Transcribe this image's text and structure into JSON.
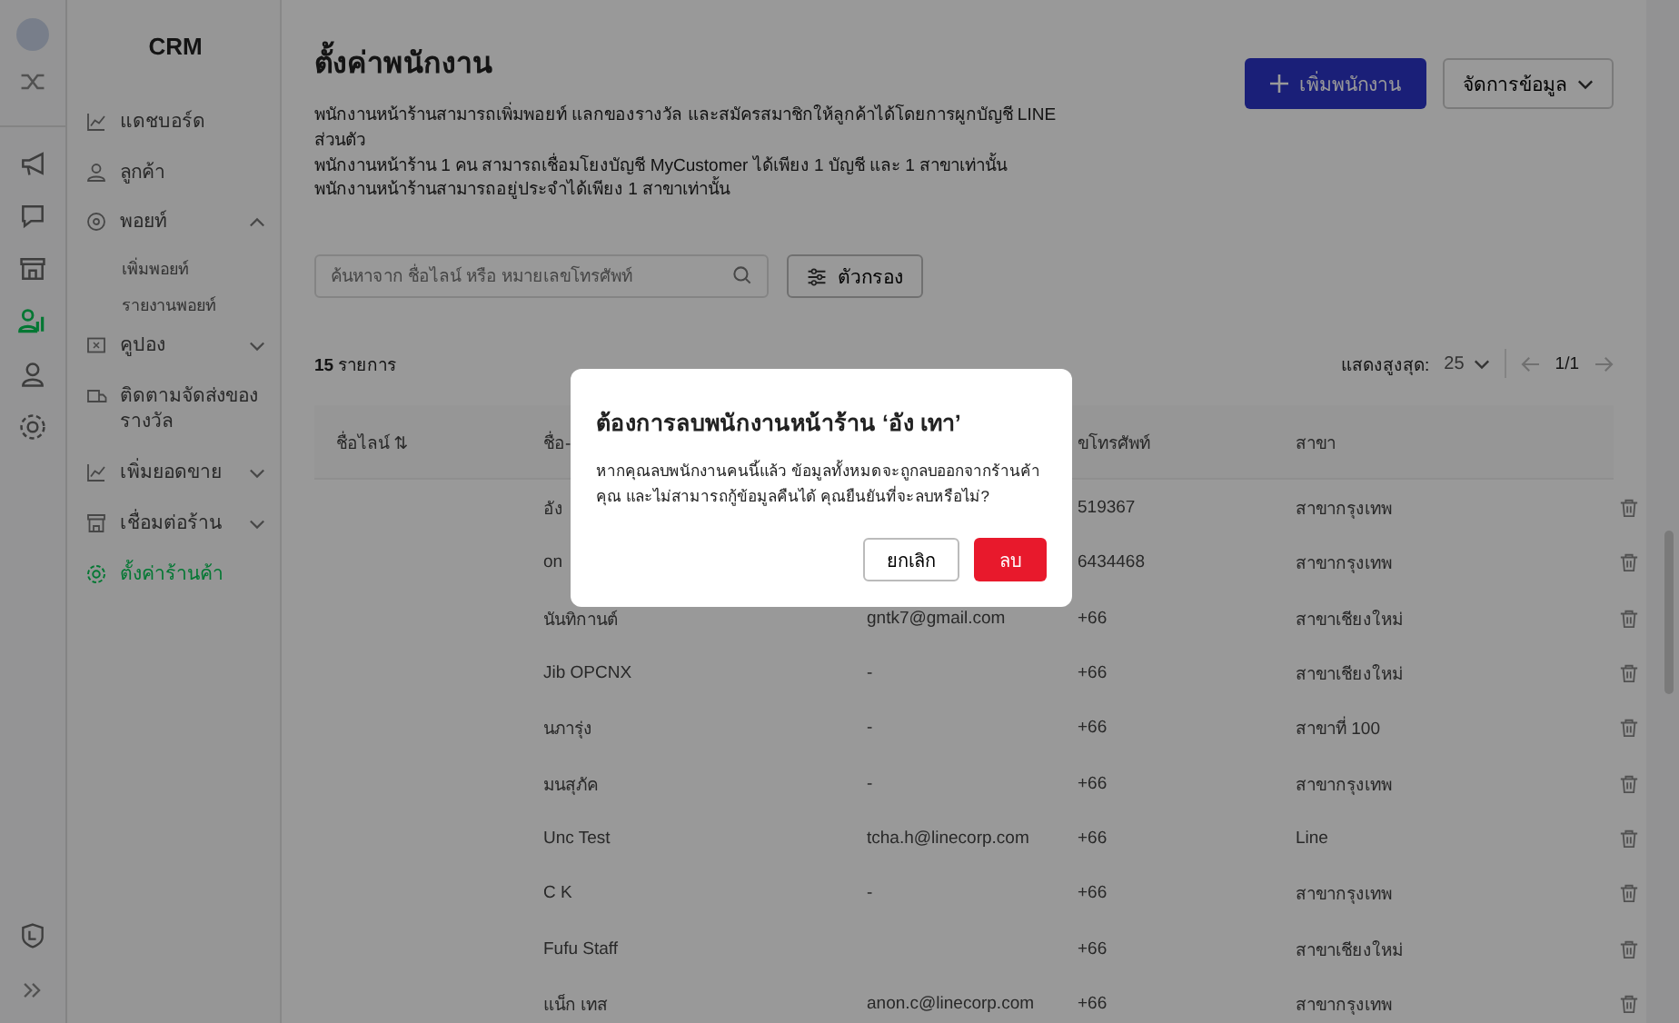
{
  "rail": {
    "top": [
      {
        "kind": "avatar"
      },
      {
        "kind": "shuffle"
      }
    ],
    "items": [
      {
        "kind": "megaphone",
        "selected": false
      },
      {
        "kind": "chat",
        "selected": false
      },
      {
        "kind": "store",
        "selected": false
      },
      {
        "kind": "staff",
        "selected": true
      },
      {
        "kind": "user",
        "selected": false
      },
      {
        "kind": "gear",
        "selected": false
      }
    ],
    "bottom": [
      {
        "kind": "shield"
      },
      {
        "kind": "expand"
      }
    ]
  },
  "sidebar": {
    "title": "CRM",
    "items": [
      {
        "label": "แดชบอร์ด",
        "selected": false
      },
      {
        "label": "ลูกค้า",
        "selected": false
      },
      {
        "label": "พอยท์",
        "selected": false,
        "expanded": true,
        "children": [
          {
            "label": "เพิ่มพอยท์",
            "selected": false
          },
          {
            "label": "รายงานพอยท์",
            "selected": false
          }
        ]
      },
      {
        "label": "คูปอง",
        "selected": false,
        "expanded": false
      },
      {
        "label": "ติดตามจัดส่งของรางวัล",
        "selected": false
      },
      {
        "label": "เพิ่มยอดขาย",
        "selected": false,
        "expanded": false
      },
      {
        "label": "เชื่อมต่อร้าน",
        "selected": false,
        "expanded": false
      },
      {
        "label": "ตั้งค่าร้านค้า",
        "selected": true
      }
    ]
  },
  "page": {
    "title": "ตั้งค่าพนักงาน",
    "description": [
      "พนักงานหน้าร้านสามารถเพิ่มพอยท์ แลกของรางวัล และสมัครสมาชิกให้ลูกค้าได้โดยการผูกบัญชี LINE ส่วนตัว",
      "พนักงานหน้าร้าน 1 คน สามารถเชื่อมโยงบัญชี MyCustomer ได้เพียง 1 บัญชี และ 1 สาขาเท่านั้น",
      "พนักงานหน้าร้านสามารถอยู่ประจำได้เพียง 1 สาขาเท่านั้น"
    ],
    "add_button": "เพิ่มพนักงาน",
    "manage_button": "จัดการข้อมูล"
  },
  "search": {
    "placeholder": "ค้นหาจาก ชื่อไลน์ หรือ หมายเลขโทรศัพท์"
  },
  "filter_button": "ตัวกรอง",
  "count": {
    "number": "15",
    "label": "รายการ"
  },
  "pagination": {
    "label": "แสดงสูงสุด:",
    "page_size": "25",
    "page": "1/1"
  },
  "table": {
    "columns": [
      "ชื่อไลน์ ⇅",
      "ชื่อ-",
      null,
      "ขโทรศัพท์",
      "สาขา"
    ],
    "rows": [
      {
        "cells": [
          null,
          "อัง",
          null,
          "519367",
          "สาขากรุงเทพ"
        ]
      },
      {
        "cells": [
          null,
          "on",
          null,
          "6434468",
          "สาขากรุงเทพ"
        ]
      },
      {
        "cells": [
          null,
          "นันทิกานต์",
          "gntk7@gmail.com",
          "+66",
          "สาขาเชียงใหม่"
        ]
      },
      {
        "cells": [
          null,
          "Jib OPCNX",
          "-",
          "+66",
          "สาขาเชียงใหม่"
        ]
      },
      {
        "cells": [
          null,
          "นภารุ่ง",
          "-",
          "+66",
          "สาขาที่ 100"
        ]
      },
      {
        "cells": [
          null,
          "มนสุภัค",
          "-",
          "+66",
          "สาขากรุงเทพ"
        ]
      },
      {
        "cells": [
          null,
          "Unc Test",
          "tcha.h@linecorp.com",
          "+66",
          "Line"
        ]
      },
      {
        "cells": [
          null,
          "C K",
          "-",
          "+66",
          "สาขากรุงเทพ"
        ]
      },
      {
        "cells": [
          null,
          "Fufu Staff",
          null,
          "+66",
          "สาขาเชียงใหม่"
        ]
      },
      {
        "cells": [
          null,
          "แน็ก เทส",
          "anon.c@linecorp.com",
          "+66",
          "สาขากรุงเทพ"
        ]
      }
    ]
  },
  "dialog": {
    "title": "ต้องการลบพนักงานหน้าร้าน ‘อัง เทา’",
    "message": "หากคุณลบพนักงานคนนี้แล้ว ข้อมูลทั้งหมดจะถูกลบออกจากร้านค้าคุณ และไม่สามารถกู้ข้อมูลคืนได้ คุณยืนยันที่จะลบหรือไม่?",
    "cancel": "ยกเลิก",
    "confirm": "ลบ"
  }
}
